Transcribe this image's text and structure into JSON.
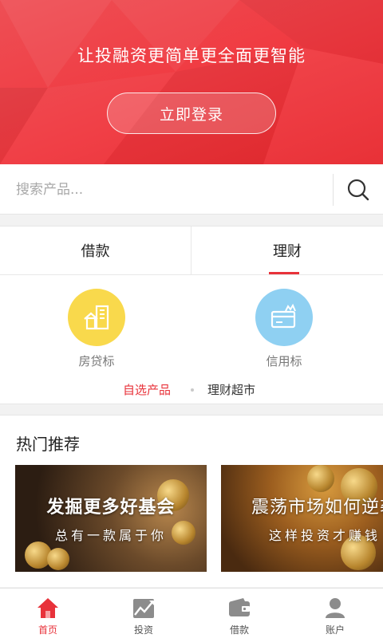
{
  "hero": {
    "slogan": "让投融资更简单更全面更智能",
    "login_label": "立即登录"
  },
  "search": {
    "placeholder": "搜索产品...",
    "icon": "search-icon"
  },
  "tabs": [
    {
      "label": "借款",
      "active": false
    },
    {
      "label": "理财",
      "active": true
    }
  ],
  "categories": [
    {
      "label": "房贷标",
      "icon": "house-building-icon",
      "color": "#f9d94c"
    },
    {
      "label": "信用标",
      "icon": "credit-card-icon",
      "color": "#8fd0f2"
    }
  ],
  "quick_links": {
    "self_select": "自选产品",
    "market": "理财超市"
  },
  "hot": {
    "title": "热门推荐",
    "banners": [
      {
        "title": "发掘更多好基会",
        "subtitle": "总有一款属于你"
      },
      {
        "title": "震荡市场如何逆袭",
        "subtitle": "这样投资才赚钱"
      }
    ]
  },
  "nav": [
    {
      "label": "首页",
      "icon": "home-icon",
      "active": true
    },
    {
      "label": "投资",
      "icon": "chart-trend-icon",
      "active": false
    },
    {
      "label": "借款",
      "icon": "wallet-icon",
      "active": false
    },
    {
      "label": "账户",
      "icon": "user-icon",
      "active": false
    }
  ],
  "colors": {
    "brand_red": "#e8323a",
    "hero_red": "#f0383f",
    "nav_inactive": "#8c8c8c"
  }
}
